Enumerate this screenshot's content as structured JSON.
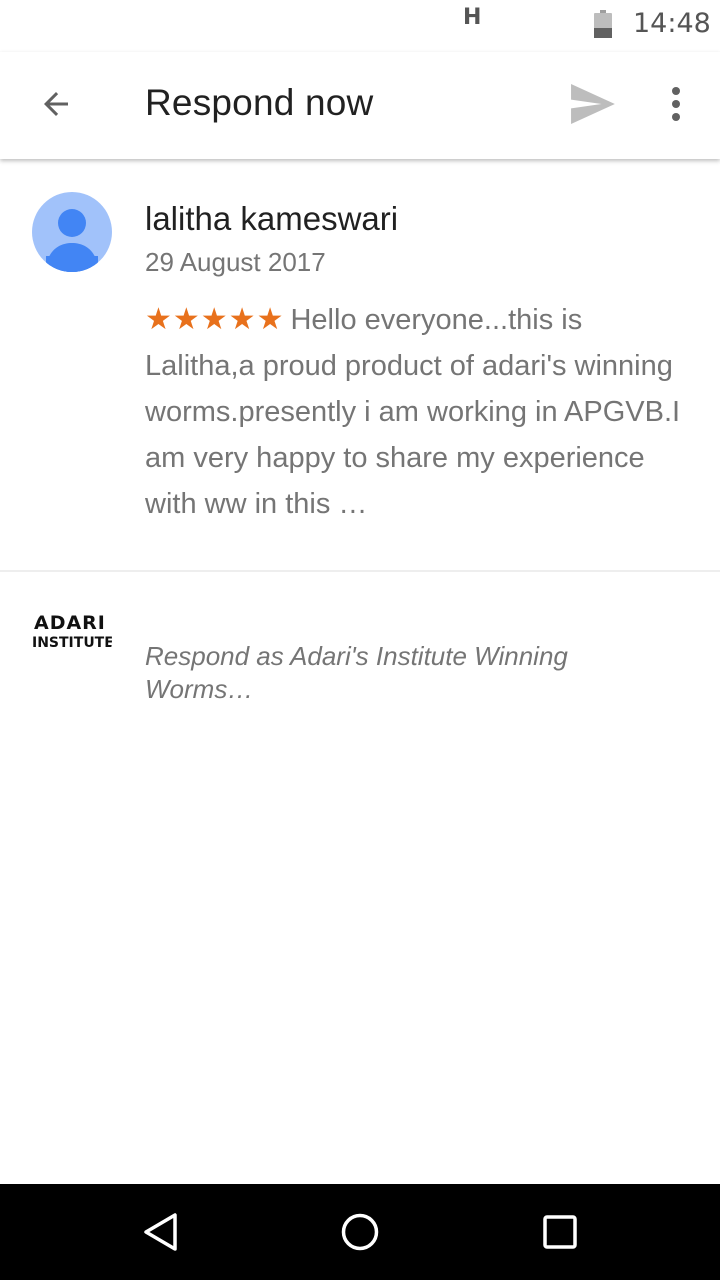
{
  "status_bar": {
    "network": "H",
    "time": "14:48"
  },
  "app_bar": {
    "title": "Respond now"
  },
  "review": {
    "reviewer_name": "lalitha kameswari",
    "date": "29 August 2017",
    "rating": 5,
    "stars_text": "★★★★★",
    "body": "Hello everyone...this is Lalitha,a proud product of adari's winning worms.presently i am working in APGVB.I am very happy to share my experience with ww in this …"
  },
  "response": {
    "logo_line1": "ADARI'S",
    "logo_line2": "INSTITUTE",
    "placeholder": "Respond as Adari's Institute Winning Worms…"
  },
  "colors": {
    "star": "#e8711c",
    "avatar_bg": "#a1c2fa",
    "avatar_fg": "#4285f4",
    "title_text": "#212121",
    "secondary_text": "#757575",
    "nav_bar": "#000000"
  },
  "icons": {
    "back": "arrow-back-icon",
    "send": "send-icon",
    "more": "more-vert-icon",
    "battery": "battery-icon",
    "nav_back": "nav-back-triangle-icon",
    "nav_home": "nav-home-circle-icon",
    "nav_recents": "nav-recents-square-icon"
  }
}
